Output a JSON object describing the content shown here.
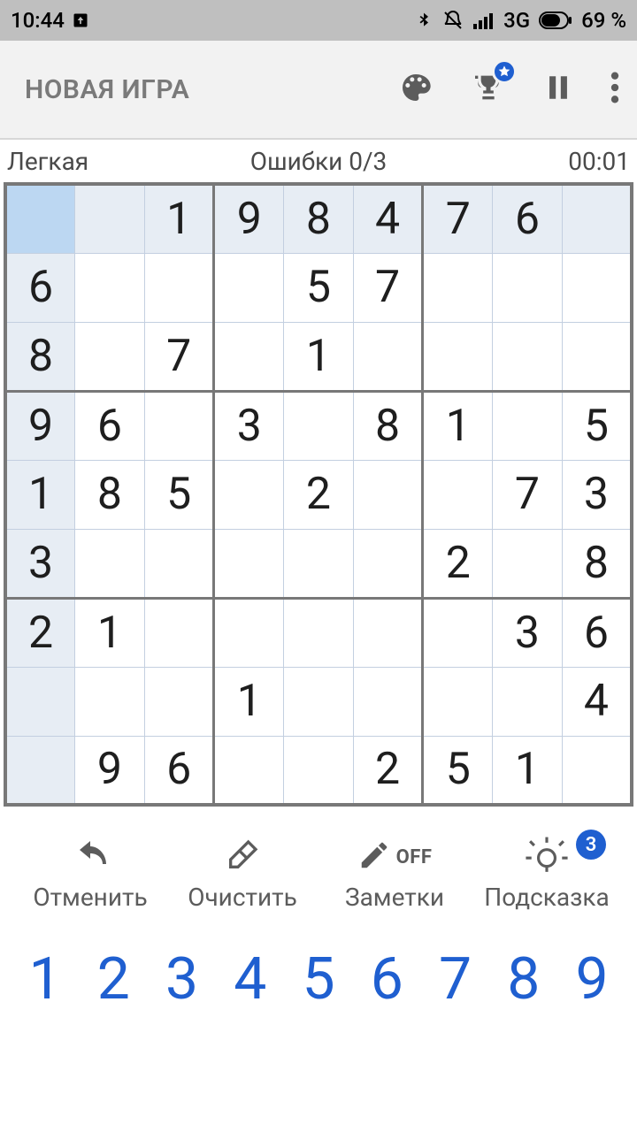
{
  "status": {
    "time": "10:44",
    "network_label": "3G",
    "battery_label": "69 %"
  },
  "appbar": {
    "title": "НОВАЯ ИГРА"
  },
  "info": {
    "difficulty": "Легкая",
    "mistakes": "Ошибки 0/3",
    "timer": "00:01"
  },
  "tools": {
    "undo": "Отменить",
    "erase": "Очистить",
    "notes": "Заметки",
    "notes_state": "OFF",
    "hint": "Подсказка",
    "hint_count": "3"
  },
  "numpad": [
    "1",
    "2",
    "3",
    "4",
    "5",
    "6",
    "7",
    "8",
    "9"
  ],
  "sudoku": {
    "selected": [
      0,
      0
    ],
    "rows": [
      [
        {
          "v": "",
          "g": true,
          "sel": true
        },
        {
          "v": "",
          "g": true
        },
        {
          "v": "1",
          "g": true
        },
        {
          "v": "9",
          "g": true
        },
        {
          "v": "8",
          "g": true
        },
        {
          "v": "4",
          "g": true
        },
        {
          "v": "7",
          "g": true
        },
        {
          "v": "6",
          "g": true
        },
        {
          "v": "",
          "g": true
        }
      ],
      [
        {
          "v": "6",
          "g": true
        },
        {
          "v": "",
          "g": false
        },
        {
          "v": "",
          "g": false
        },
        {
          "v": "",
          "g": false
        },
        {
          "v": "5",
          "g": false
        },
        {
          "v": "7",
          "g": false
        },
        {
          "v": "",
          "g": false
        },
        {
          "v": "",
          "g": false
        },
        {
          "v": "",
          "g": false
        }
      ],
      [
        {
          "v": "8",
          "g": true
        },
        {
          "v": "",
          "g": false
        },
        {
          "v": "7",
          "g": false
        },
        {
          "v": "",
          "g": false
        },
        {
          "v": "1",
          "g": false
        },
        {
          "v": "",
          "g": false
        },
        {
          "v": "",
          "g": false
        },
        {
          "v": "",
          "g": false
        },
        {
          "v": "",
          "g": false
        }
      ],
      [
        {
          "v": "9",
          "g": true
        },
        {
          "v": "6",
          "g": false
        },
        {
          "v": "",
          "g": false
        },
        {
          "v": "3",
          "g": false
        },
        {
          "v": "",
          "g": false
        },
        {
          "v": "8",
          "g": false
        },
        {
          "v": "1",
          "g": false
        },
        {
          "v": "",
          "g": false
        },
        {
          "v": "5",
          "g": false
        }
      ],
      [
        {
          "v": "1",
          "g": true
        },
        {
          "v": "8",
          "g": false
        },
        {
          "v": "5",
          "g": false
        },
        {
          "v": "",
          "g": false
        },
        {
          "v": "2",
          "g": false
        },
        {
          "v": "",
          "g": false
        },
        {
          "v": "",
          "g": false
        },
        {
          "v": "7",
          "g": false
        },
        {
          "v": "3",
          "g": false
        }
      ],
      [
        {
          "v": "3",
          "g": true
        },
        {
          "v": "",
          "g": false
        },
        {
          "v": "",
          "g": false
        },
        {
          "v": "",
          "g": false
        },
        {
          "v": "",
          "g": false
        },
        {
          "v": "",
          "g": false
        },
        {
          "v": "2",
          "g": false
        },
        {
          "v": "",
          "g": false
        },
        {
          "v": "8",
          "g": false
        }
      ],
      [
        {
          "v": "2",
          "g": true
        },
        {
          "v": "1",
          "g": false
        },
        {
          "v": "",
          "g": false
        },
        {
          "v": "",
          "g": false
        },
        {
          "v": "",
          "g": false
        },
        {
          "v": "",
          "g": false
        },
        {
          "v": "",
          "g": false
        },
        {
          "v": "3",
          "g": false
        },
        {
          "v": "6",
          "g": false
        }
      ],
      [
        {
          "v": "",
          "g": true
        },
        {
          "v": "",
          "g": false
        },
        {
          "v": "",
          "g": false
        },
        {
          "v": "1",
          "g": false
        },
        {
          "v": "",
          "g": false
        },
        {
          "v": "",
          "g": false
        },
        {
          "v": "",
          "g": false
        },
        {
          "v": "",
          "g": false
        },
        {
          "v": "4",
          "g": false
        }
      ],
      [
        {
          "v": "",
          "g": true
        },
        {
          "v": "9",
          "g": false
        },
        {
          "v": "6",
          "g": false
        },
        {
          "v": "",
          "g": false
        },
        {
          "v": "",
          "g": false
        },
        {
          "v": "2",
          "g": false
        },
        {
          "v": "5",
          "g": false
        },
        {
          "v": "1",
          "g": false
        },
        {
          "v": "",
          "g": false
        }
      ]
    ]
  }
}
